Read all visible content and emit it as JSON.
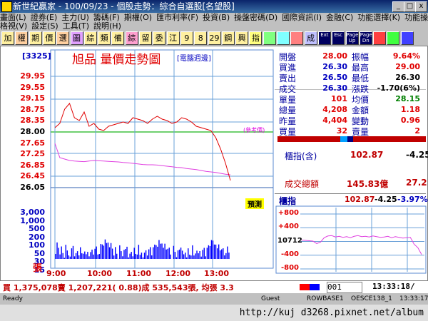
{
  "window": {
    "title": "新世紀贏家 - 100/09/23 - 個股走勢：綜合自選股[名望股]",
    "min": "_",
    "max": "□",
    "close": "x"
  },
  "menu_row1": [
    "畫面(L)",
    "證券(E)",
    "主力(U)",
    "籌碼(F)",
    "期權(O)",
    "匯市利率(F)",
    "投資(B)",
    "操盤密碼(D)",
    "國際資訊(I)",
    "金融(C)",
    "功能選擇(K)",
    "功能操作(E)"
  ],
  "menu_row2": [
    "格視(V)",
    "設定(S)",
    "工具(T)",
    "說明(H)"
  ],
  "toolbar": [
    "加",
    "權",
    "期",
    "價",
    "選",
    "圖",
    "綜",
    "類",
    "備",
    "綜",
    "留",
    "委",
    "江",
    "9",
    "8",
    "29",
    "鋼",
    "興",
    "指",
    "",
    "",
    "",
    "成",
    "Ext",
    "Esc",
    "Page Up",
    "Page Dn",
    "",
    "",
    ""
  ],
  "chart": {
    "code": "[3325]",
    "name": "旭品  量價走勢圖",
    "tag": "[電腦週邊]",
    "ref_tag": "(參考價)",
    "ref_line_price": 28.0,
    "badge": "預測",
    "price_ticks": [
      "29.95",
      "29.55",
      "29.15",
      "28.75",
      "28.35",
      "28.00",
      "27.65",
      "27.25",
      "26.85",
      "26.45",
      "26.05"
    ],
    "vol_ticks": [
      "3,000",
      "1,000",
      "500",
      "200",
      "100",
      "50",
      "30",
      "15"
    ],
    "vol_unit": "張",
    "time_ticks": [
      "9:00",
      "10:00",
      "11:00",
      "12:00",
      "13:00"
    ],
    "price_series": [
      28.15,
      28.3,
      28.8,
      29.0,
      28.5,
      28.4,
      28.7,
      28.2,
      28.3,
      28.1,
      28.05,
      28.2,
      28.25,
      28.3,
      28.35,
      28.3,
      28.5,
      28.45,
      28.4,
      28.3,
      28.45,
      28.55,
      28.45,
      28.4,
      28.3,
      28.35,
      28.5,
      28.45,
      28.35,
      28.2,
      28.15,
      28.1,
      28.05,
      27.8,
      27.4,
      26.9,
      26.3
    ],
    "avg_series": [
      27.6,
      27.1,
      27.05,
      27.0,
      26.98,
      26.97,
      26.96,
      26.98,
      27.0,
      26.99,
      26.98,
      26.97,
      26.96,
      26.95,
      26.93,
      26.92,
      26.9,
      26.88,
      26.86,
      26.85,
      26.85,
      26.84,
      26.82,
      26.8,
      26.78,
      26.76,
      26.75,
      26.72,
      26.7,
      26.68,
      26.65,
      26.62,
      26.6,
      26.58,
      26.55,
      26.52,
      26.5
    ],
    "volume_series": [
      30,
      60,
      40,
      25,
      35,
      20,
      15,
      40,
      25,
      18,
      22,
      30,
      50,
      20,
      16,
      25,
      20,
      30,
      18,
      22,
      40,
      15,
      25,
      20,
      18,
      30,
      22,
      25,
      40,
      20,
      30,
      50,
      60,
      70,
      80,
      65,
      90
    ]
  },
  "quote": {
    "rows": [
      {
        "l1": "開盤",
        "v1": "28.00",
        "c1": "red",
        "l2": "振幅",
        "v2": "9.64%",
        "c2": "red"
      },
      {
        "l1": "買進",
        "v1": "26.30",
        "c1": "blue",
        "l2": "最高",
        "v2": "29.00",
        "c2": "red"
      },
      {
        "l1": "賣出",
        "v1": "26.50",
        "c1": "blue",
        "l2": "最低",
        "v2": "26.30",
        "c2": "black"
      },
      {
        "l1": "成交",
        "v1": "26.30",
        "c1": "blue",
        "l2": "漲跌",
        "v2": "-1.70(6%)",
        "c2": "black"
      },
      {
        "l1": "單量",
        "v1": "101",
        "c1": "red",
        "l2": "均價",
        "v2": "28.15",
        "c2": "green"
      },
      {
        "l1": "總量",
        "v1": "4,208",
        "c1": "red",
        "l2": "金額",
        "v2": "1.18",
        "c2": "red"
      },
      {
        "l1": "昨量",
        "v1": "4,404",
        "c1": "red",
        "l2": "變動",
        "v2": "0.96",
        "c2": "red"
      },
      {
        "l1": "買量",
        "v1": "32",
        "c1": "red",
        "l2": "賣量",
        "v2": "2",
        "c2": "red"
      }
    ],
    "index_label": "櫃指(含)",
    "index_value": "102.87",
    "index_change": "-4.25",
    "turnover_label": "成交總額",
    "turnover_value": "145.83億",
    "turnover_change": "27.2"
  },
  "mini": {
    "label": "櫃指",
    "value": "102.87",
    "change": "-4.25",
    "pct": "-3.97%",
    "ticks": [
      "+800",
      "+400",
      "10712",
      "-400",
      "-800"
    ],
    "series": [
      40,
      30,
      20,
      10,
      -60,
      -20,
      110,
      160,
      170,
      130,
      150,
      120,
      140,
      110,
      150,
      170,
      140,
      150,
      130,
      160,
      140,
      120,
      130,
      150,
      110,
      140,
      120,
      100,
      110,
      120,
      -80,
      -180,
      -380
    ]
  },
  "status_line": "買 1,375,078賣 1,207,221( 0.88)成 535,543張, 均張 3.3",
  "status_code": "001",
  "clock": "13:33:18/",
  "statusbar": [
    "Ready",
    "Guest",
    "ROWBASE1",
    "OESCE138_1",
    "13:33:17"
  ],
  "address": "http://kuj d3268.pixnet.net/album",
  "colors": {
    "price_line": "#e00000",
    "avg_line": "#e040e0",
    "vol_bar": "#0000ff",
    "grid": "#6aa0d8",
    "ref": "#40c040"
  }
}
